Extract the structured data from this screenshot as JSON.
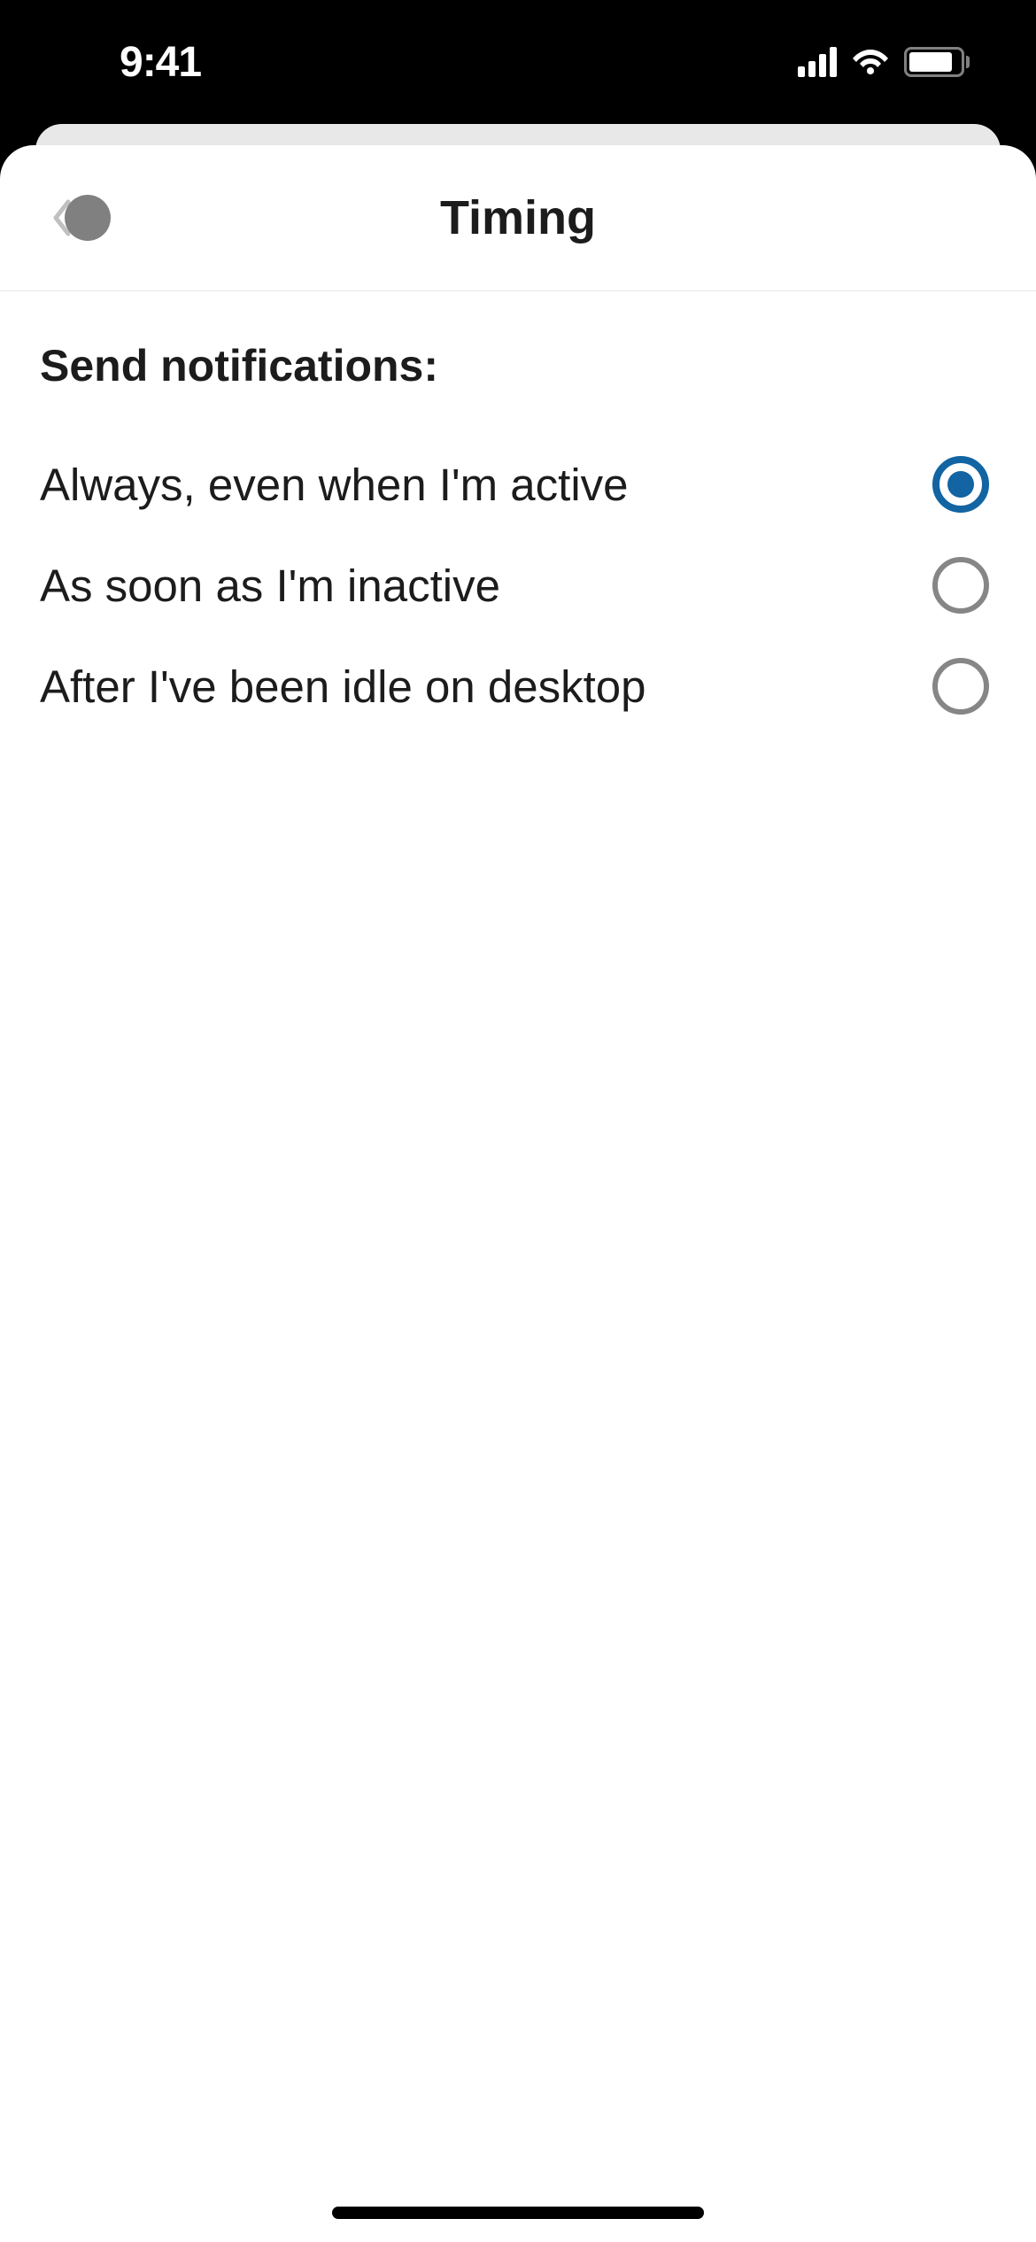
{
  "statusBar": {
    "time": "9:41"
  },
  "header": {
    "title": "Timing"
  },
  "content": {
    "sectionLabel": "Send notifications:",
    "options": [
      {
        "label": "Always, even when I'm active",
        "selected": true
      },
      {
        "label": "As soon as I'm inactive",
        "selected": false
      },
      {
        "label": "After I've been idle on desktop",
        "selected": false
      }
    ]
  }
}
